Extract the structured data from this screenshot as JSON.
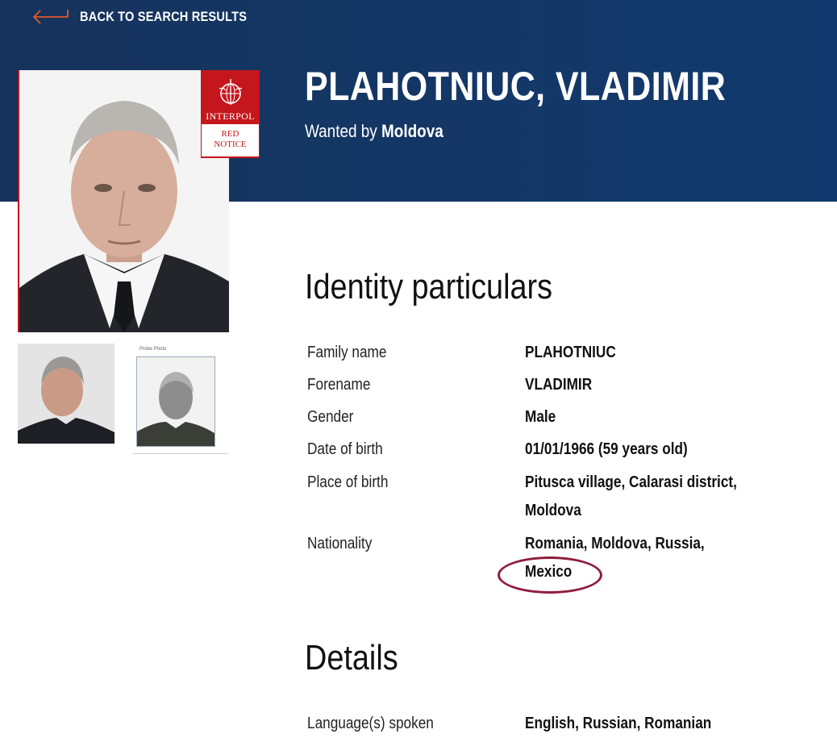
{
  "nav": {
    "back_label": "BACK TO SEARCH RESULTS"
  },
  "notice": {
    "name": "PLAHOTNIUC, VLADIMIR",
    "wanted_prefix": "Wanted by",
    "wanted_country": "Moldova",
    "badge_brand": "INTERPOL",
    "badge_type_line1": "RED",
    "badge_type_line2": "NOTICE",
    "probe_caption": "Probe Photo"
  },
  "identity": {
    "heading": "Identity particulars",
    "rows": [
      {
        "label": "Family name",
        "value_lines": [
          "PLAHOTNIUC"
        ]
      },
      {
        "label": "Forename",
        "value_lines": [
          "VLADIMIR"
        ]
      },
      {
        "label": "Gender",
        "value_lines": [
          "Male"
        ]
      },
      {
        "label": "Date of birth",
        "value_lines": [
          "01/01/1966 (59 years old)"
        ]
      },
      {
        "label": "Place of birth",
        "value_lines": [
          "Pitusca village, Calarasi district,",
          "Moldova"
        ]
      },
      {
        "label": "Nationality",
        "value_lines": [
          "Romania, Moldova, Russia,",
          "Mexico"
        ]
      }
    ]
  },
  "details": {
    "heading": "Details",
    "rows": [
      {
        "label": "Language(s) spoken",
        "value_lines": [
          "English, Russian, Romanian"
        ]
      }
    ]
  },
  "colors": {
    "header_bg": "#15386a",
    "badge_red": "#c4161c",
    "back_arrow": "#e2572b",
    "annotation_circle": "#8e1d3d"
  }
}
